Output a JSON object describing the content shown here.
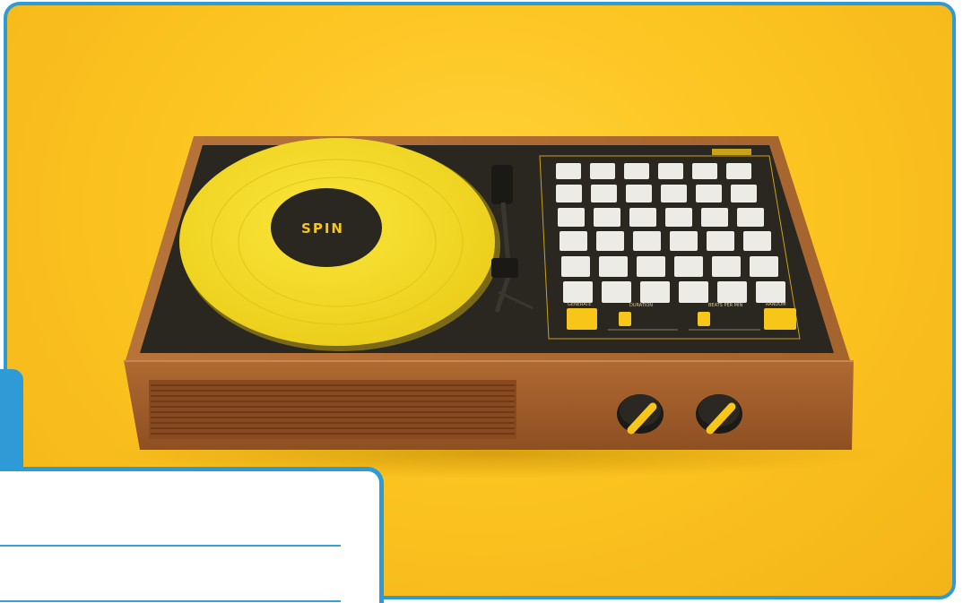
{
  "photo": {
    "record_label": "SPIN",
    "button_labels": {
      "generate": "GENERATE",
      "duration": "DURATION",
      "beats_per_min": "BEATS PER MIN",
      "random": "RANDOM"
    }
  },
  "colors": {
    "background": "#fcc521",
    "frame_border": "#2f9bd6",
    "wood": "#a35f2c",
    "deck_panel": "#2a2620",
    "vinyl": "#f4dc28",
    "pad": "#ecebe6",
    "accent_yellow": "#f7c619"
  },
  "caption": {
    "lines": [
      "",
      ""
    ]
  }
}
